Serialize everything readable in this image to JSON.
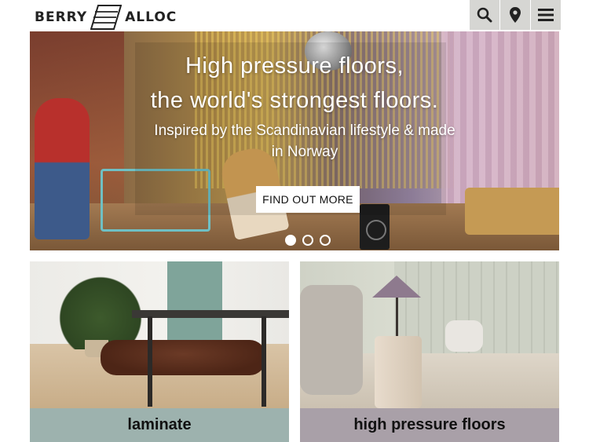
{
  "header": {
    "logo_left": "BERRY",
    "logo_right": "ALLOC",
    "icons": [
      "search-icon",
      "location-pin-icon",
      "hamburger-menu-icon"
    ]
  },
  "hero": {
    "title_line1": "High pressure floors,",
    "title_line2": "the world's strongest floors.",
    "subtitle": "Inspired by the Scandinavian lifestyle & made in Norway",
    "cta_label": "FIND OUT MORE",
    "slide_count": 3,
    "active_slide": 1
  },
  "cards": [
    {
      "label": "laminate",
      "color": "#9db2ae"
    },
    {
      "label": "high pressure floors",
      "color": "#a9a0a8"
    }
  ]
}
